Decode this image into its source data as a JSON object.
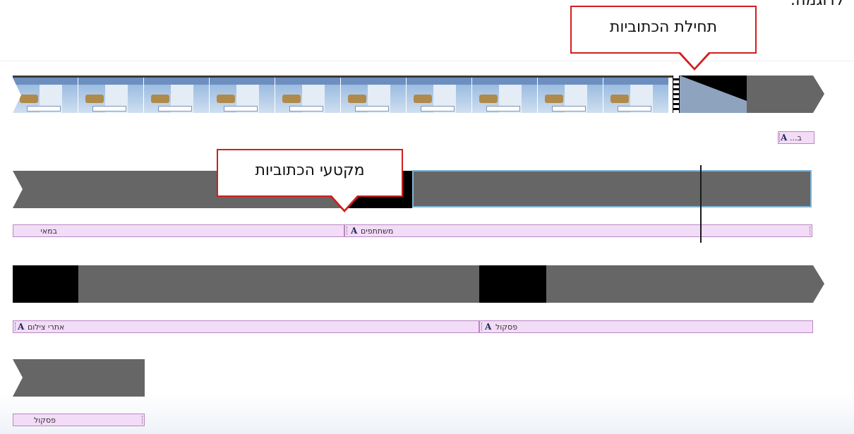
{
  "page": {
    "top_text": "לדוגמה:"
  },
  "callouts": {
    "subtitle_start": "תחילת הכתוביות",
    "subtitle_segments": "מקטעי הכתוביות"
  },
  "tracks": {
    "row1": {
      "caption_label": "ב..."
    },
    "row2": {
      "clips": [
        {
          "label": "במאי"
        },
        {
          "label": "משתתפים"
        }
      ]
    },
    "row3": {
      "clips": [
        {
          "label": "אתרי צילום"
        },
        {
          "label": "פסקול"
        }
      ]
    },
    "row4": {
      "clips": [
        {
          "label": "פסקול"
        }
      ]
    }
  },
  "icons": {
    "caption_clip": "caption-a-icon",
    "film_transition": "film-strip-icon",
    "track_end": "chevron-right-icon"
  },
  "colors": {
    "track_gray": "#666666",
    "caption_fill": "#f3dcf7",
    "callout_border": "#d11f1f",
    "selection_border": "#7fb4d6"
  }
}
